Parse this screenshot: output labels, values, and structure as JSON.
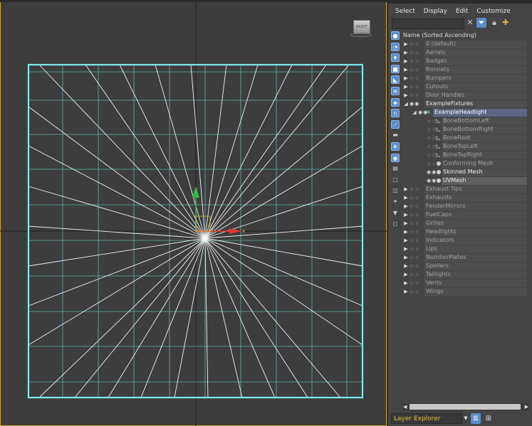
{
  "viewport": {
    "viewcube_label": "RIGHT",
    "axis_x_label": "x"
  },
  "panel": {
    "menu": [
      "Select",
      "Display",
      "Edit",
      "Customize"
    ],
    "toolbar": {
      "clear_icon": "close-icon",
      "filter_icon": "filter-icon",
      "lock_icon": "lock-icon",
      "add_layer_icon": "add-layer-icon"
    },
    "tree_header": "Name (Sorted Ascending)",
    "tree": [
      {
        "label": "0 (default)",
        "level": 0,
        "arrow": "▶"
      },
      {
        "label": "Aerials",
        "level": 0,
        "arrow": "▶"
      },
      {
        "label": "Badges",
        "level": 0,
        "arrow": "▶"
      },
      {
        "label": "Bonnets",
        "level": 0,
        "arrow": "▶"
      },
      {
        "label": "Bumpers",
        "level": 0,
        "arrow": "▶"
      },
      {
        "label": "Cutouts",
        "level": 0,
        "arrow": "▶"
      },
      {
        "label": "Door Handles",
        "level": 0,
        "arrow": "▶"
      },
      {
        "label": "ExampleFixtures",
        "level": 0,
        "arrow": "◢",
        "bright": true,
        "eye": true
      },
      {
        "label": "ExampleHeadlight",
        "level": 1,
        "arrow": "◢",
        "selected": true,
        "eye": true
      },
      {
        "label": "BoneBottomLeft",
        "level": 2,
        "kind": "bone"
      },
      {
        "label": "BoneBottomRight",
        "level": 2,
        "kind": "bone"
      },
      {
        "label": "BoneRoot",
        "level": 2,
        "kind": "bone"
      },
      {
        "label": "BoneTopLeft",
        "level": 2,
        "kind": "bone"
      },
      {
        "label": "BoneTopRight",
        "level": 2,
        "kind": "bone"
      },
      {
        "label": "Conforming Mesh",
        "level": 2,
        "kind": "mesh"
      },
      {
        "label": "Skinned Mesh",
        "level": 2,
        "kind": "mesh",
        "bright": true,
        "eye": true
      },
      {
        "label": "UVMesh",
        "level": 2,
        "kind": "mesh",
        "bright": true,
        "eye": true,
        "highlight": true
      },
      {
        "label": "Exhaust Tips",
        "level": 0,
        "arrow": "▶"
      },
      {
        "label": "Exhausts",
        "level": 0,
        "arrow": "▶"
      },
      {
        "label": "FenderMirrors",
        "level": 0,
        "arrow": "▶"
      },
      {
        "label": "FuelCaps",
        "level": 0,
        "arrow": "▶"
      },
      {
        "label": "Grilles",
        "level": 0,
        "arrow": "▶"
      },
      {
        "label": "Headlights",
        "level": 0,
        "arrow": "▶"
      },
      {
        "label": "Indicators",
        "level": 0,
        "arrow": "▶"
      },
      {
        "label": "Lips",
        "level": 0,
        "arrow": "▶"
      },
      {
        "label": "NumberPlates",
        "level": 0,
        "arrow": "▶"
      },
      {
        "label": "Spoilers",
        "level": 0,
        "arrow": "▶"
      },
      {
        "label": "Taillights",
        "level": 0,
        "arrow": "▶"
      },
      {
        "label": "Vents",
        "level": 0,
        "arrow": "▶"
      },
      {
        "label": "Wings",
        "level": 0,
        "arrow": "▶"
      }
    ],
    "explorer_name": "Layer Explorer"
  },
  "colors": {
    "accent": "#5a8cc8",
    "viewport_border": "#d9a520",
    "mesh_border": "#7fe9ea",
    "grid": "#5fc9c0",
    "label_yellow": "#e1c24a"
  }
}
